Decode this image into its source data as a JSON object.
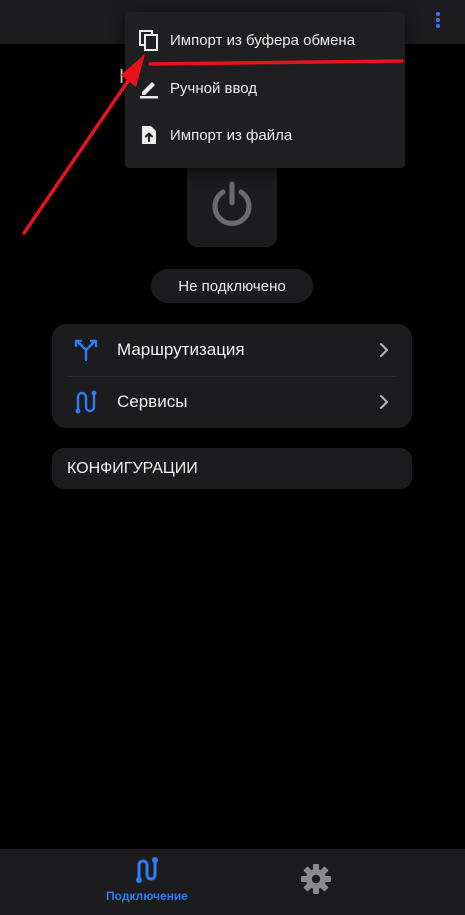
{
  "header": {
    "more_icon": "more-vert-icon",
    "accent": "#2f7cf6"
  },
  "background_partial_char": "Н",
  "context_menu": {
    "items": [
      {
        "label": "Импорт из буфера обмена",
        "icon": "clipboard-copy-icon"
      },
      {
        "label": "Ручной ввод",
        "icon": "edit-pencil-icon"
      },
      {
        "label": "Импорт из файла",
        "icon": "file-upload-icon"
      }
    ]
  },
  "power": {
    "icon": "power-icon",
    "status": "Не подключено"
  },
  "menu_card": {
    "items": [
      {
        "label": "Маршрутизация",
        "icon": "routing-split-icon"
      },
      {
        "label": "Сервисы",
        "icon": "services-icon"
      }
    ]
  },
  "config": {
    "label": "КОНФИГУРАЦИИ"
  },
  "bottom_nav": {
    "connection_label": "Подключение",
    "connection_icon": "connection-icon",
    "settings_icon": "gear-icon"
  },
  "colors": {
    "background": "#000000",
    "surface": "#1c1c1e",
    "accent": "#2f7cf6",
    "annotation": "#e8121c"
  }
}
